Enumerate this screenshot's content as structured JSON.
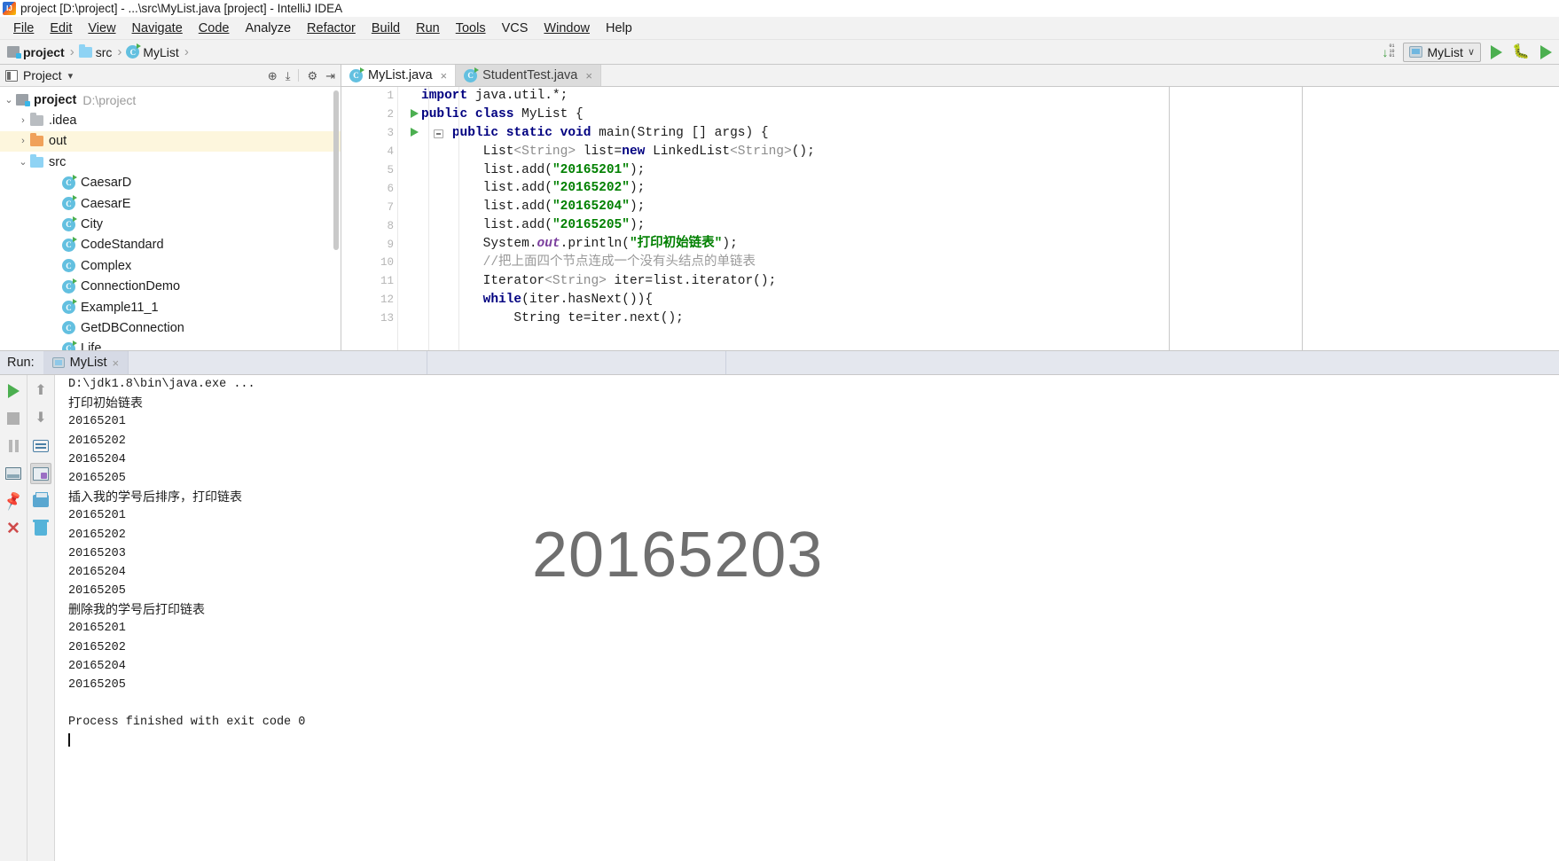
{
  "window": {
    "title": "project [D:\\project] - ...\\src\\MyList.java [project] - IntelliJ IDEA",
    "app_icon": "intellij-idea-logo"
  },
  "menubar": {
    "items": [
      {
        "label": "File"
      },
      {
        "label": "Edit"
      },
      {
        "label": "View"
      },
      {
        "label": "Navigate"
      },
      {
        "label": "Code"
      },
      {
        "label": "Analyze"
      },
      {
        "label": "Refactor"
      },
      {
        "label": "Build"
      },
      {
        "label": "Run"
      },
      {
        "label": "Tools"
      },
      {
        "label": "VCS"
      },
      {
        "label": "Window"
      },
      {
        "label": "Help"
      }
    ]
  },
  "navbar": {
    "breadcrumbs": [
      {
        "label": "project",
        "icon": "project-icon",
        "bold": true
      },
      {
        "label": "src",
        "icon": "folder-icon",
        "bold": false
      },
      {
        "label": "MyList",
        "icon": "java-class-icon",
        "bold": false
      }
    ],
    "separator": "›",
    "run_config": {
      "name": "MyList",
      "icon": "run-configuration-icon",
      "chevron": "∨"
    },
    "buttons": [
      {
        "name": "download-updates-icon",
        "label": ""
      },
      {
        "name": "run-button",
        "label": ""
      },
      {
        "name": "debug-button",
        "label": ""
      }
    ]
  },
  "sidebar": {
    "title": "Project",
    "chevron": "▾",
    "tools": [
      {
        "name": "collapse-scope-icon",
        "glyph": "⊕"
      },
      {
        "name": "collapse-all-icon",
        "glyph": "⤓"
      },
      {
        "name": "settings-gear-icon",
        "glyph": "⚙"
      },
      {
        "name": "hide-panel-icon",
        "glyph": "⇥"
      }
    ],
    "tree": [
      {
        "arrow": "⌄",
        "icon": "project-icon",
        "label": "project",
        "sub": "D:\\project",
        "indent": 0,
        "bold": true,
        "highlight": false
      },
      {
        "arrow": "›",
        "icon": "folder-grey-icon",
        "label": ".idea",
        "sub": "",
        "indent": 1,
        "bold": false,
        "highlight": false
      },
      {
        "arrow": "›",
        "icon": "folder-orange-icon",
        "label": "out",
        "sub": "",
        "indent": 1,
        "bold": false,
        "highlight": true
      },
      {
        "arrow": "⌄",
        "icon": "folder-blue-icon",
        "label": "src",
        "sub": "",
        "indent": 1,
        "bold": false,
        "highlight": false
      },
      {
        "arrow": "",
        "icon": "java-class-runnable-icon",
        "label": "CaesarD",
        "sub": "",
        "indent": 2,
        "bold": false,
        "highlight": false
      },
      {
        "arrow": "",
        "icon": "java-class-runnable-icon",
        "label": "CaesarE",
        "sub": "",
        "indent": 2,
        "bold": false,
        "highlight": false
      },
      {
        "arrow": "",
        "icon": "java-class-runnable-icon",
        "label": "City",
        "sub": "",
        "indent": 2,
        "bold": false,
        "highlight": false
      },
      {
        "arrow": "",
        "icon": "java-class-runnable-icon",
        "label": "CodeStandard",
        "sub": "",
        "indent": 2,
        "bold": false,
        "highlight": false
      },
      {
        "arrow": "",
        "icon": "java-class-icon",
        "label": "Complex",
        "sub": "",
        "indent": 2,
        "bold": false,
        "highlight": false
      },
      {
        "arrow": "",
        "icon": "java-class-runnable-icon",
        "label": "ConnectionDemo",
        "sub": "",
        "indent": 2,
        "bold": false,
        "highlight": false
      },
      {
        "arrow": "",
        "icon": "java-class-runnable-icon",
        "label": "Example11_1",
        "sub": "",
        "indent": 2,
        "bold": false,
        "highlight": false
      },
      {
        "arrow": "",
        "icon": "java-class-icon",
        "label": "GetDBConnection",
        "sub": "",
        "indent": 2,
        "bold": false,
        "highlight": false
      },
      {
        "arrow": "",
        "icon": "java-class-runnable-icon",
        "label": "Life",
        "sub": "",
        "indent": 2,
        "bold": false,
        "highlight": false
      }
    ]
  },
  "editor": {
    "tabs": [
      {
        "label": "MyList.java",
        "icon": "java-class-icon",
        "active": true,
        "close": "×"
      },
      {
        "label": "StudentTest.java",
        "icon": "java-class-icon",
        "active": false,
        "close": "×"
      }
    ],
    "lines": [
      {
        "num": "1",
        "runmark": false,
        "fold": false
      },
      {
        "num": "2",
        "runmark": true,
        "fold": false
      },
      {
        "num": "3",
        "runmark": true,
        "fold": true
      },
      {
        "num": "4",
        "runmark": false,
        "fold": false
      },
      {
        "num": "5",
        "runmark": false,
        "fold": false
      },
      {
        "num": "6",
        "runmark": false,
        "fold": false
      },
      {
        "num": "7",
        "runmark": false,
        "fold": false
      },
      {
        "num": "8",
        "runmark": false,
        "fold": false
      },
      {
        "num": "9",
        "runmark": false,
        "fold": false
      },
      {
        "num": "10",
        "runmark": false,
        "fold": false
      },
      {
        "num": "11",
        "runmark": false,
        "fold": false
      },
      {
        "num": "12",
        "runmark": false,
        "fold": false
      },
      {
        "num": "13",
        "runmark": false,
        "fold": false
      }
    ],
    "code": {
      "l1": "import java.util.*;",
      "l2": "public class MyList {",
      "l3": "public static void main(String [] args) {",
      "l4": "List<String> list=new LinkedList<String>();",
      "l5": "list.add(\"20165201\");",
      "l6": "list.add(\"20165202\");",
      "l7": "list.add(\"20165204\");",
      "l8": "list.add(\"20165205\");",
      "l9": "System.out.println(\"打印初始链表\");",
      "l10": "//把上面四个节点连成一个没有头结点的单链表",
      "l11": "Iterator<String> iter=list.iterator();",
      "l12": "while(iter.hasNext()){",
      "l13": "String te=iter.next();"
    }
  },
  "run_panel": {
    "label": "Run:",
    "tab": {
      "label": "MyList",
      "icon": "run-configuration-icon",
      "close": "×"
    },
    "left_toolbar": [
      {
        "name": "rerun-button",
        "glyph": "run"
      },
      {
        "name": "stop-button",
        "glyph": "stop"
      },
      {
        "name": "pause-button",
        "glyph": "pause"
      },
      {
        "name": "toggle-console-button",
        "glyph": "console"
      },
      {
        "name": "pin-tab-button",
        "glyph": "pin"
      },
      {
        "name": "close-button",
        "glyph": "close"
      }
    ],
    "right_toolbar": [
      {
        "name": "scroll-up-button",
        "glyph": "up"
      },
      {
        "name": "scroll-down-button",
        "glyph": "down"
      },
      {
        "name": "soft-wrap-button",
        "glyph": "wrap"
      },
      {
        "name": "scroll-to-end-button",
        "glyph": "scroll-end",
        "selected": true
      },
      {
        "name": "print-button",
        "glyph": "print"
      },
      {
        "name": "clear-all-button",
        "glyph": "trash"
      }
    ],
    "console_lines": [
      {
        "text": "D:\\jdk1.8\\bin\\java.exe ...",
        "style": "cmd"
      },
      {
        "text": "打印初始链表",
        "style": "cn"
      },
      {
        "text": "20165201",
        "style": "mono"
      },
      {
        "text": "20165202",
        "style": "mono"
      },
      {
        "text": "20165204",
        "style": "mono"
      },
      {
        "text": "20165205",
        "style": "mono"
      },
      {
        "text": "插入我的学号后排序，打印链表",
        "style": "cn"
      },
      {
        "text": "20165201",
        "style": "mono"
      },
      {
        "text": "20165202",
        "style": "mono"
      },
      {
        "text": "20165203",
        "style": "mono"
      },
      {
        "text": "20165204",
        "style": "mono"
      },
      {
        "text": "20165205",
        "style": "mono"
      },
      {
        "text": "删除我的学号后打印链表",
        "style": "cn"
      },
      {
        "text": "20165201",
        "style": "mono"
      },
      {
        "text": "20165202",
        "style": "mono"
      },
      {
        "text": "20165204",
        "style": "mono"
      },
      {
        "text": "20165205",
        "style": "mono"
      },
      {
        "text": "",
        "style": "mono"
      },
      {
        "text": "Process finished with exit code 0",
        "style": "mono"
      }
    ],
    "watermark": "20165203"
  }
}
